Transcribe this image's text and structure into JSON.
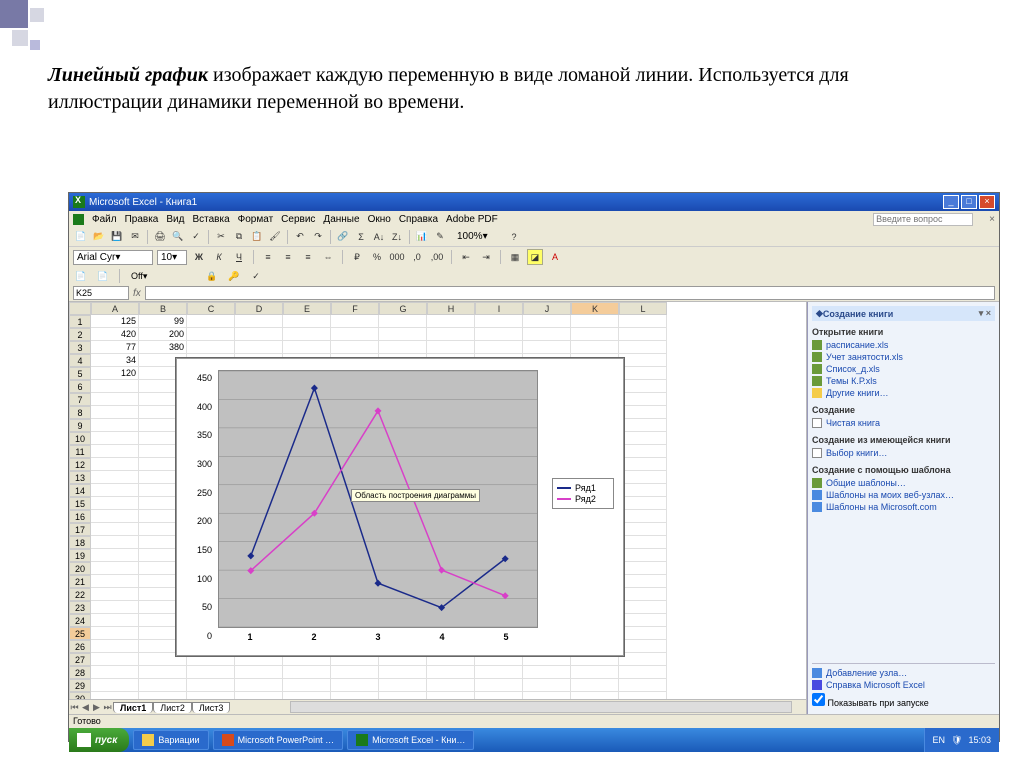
{
  "slide": {
    "term": "Линейный график",
    "rest": " изображает каждую переменную в виде ломаной линии. Используется для иллюстрации динамики переменной во времени."
  },
  "titlebar": {
    "text": "Microsoft Excel - Книга1"
  },
  "window_buttons": {
    "min": "_",
    "max": "□",
    "close": "×"
  },
  "menubar": {
    "items": [
      "Файл",
      "Правка",
      "Вид",
      "Вставка",
      "Формат",
      "Сервис",
      "Данные",
      "Окно",
      "Справка",
      "Adobe PDF"
    ],
    "question": "Введите вопрос",
    "doc_close": "×"
  },
  "fmtbar": {
    "font": "Arial Cyr",
    "size": "10",
    "bold": "Ж",
    "italic": "К",
    "underline": "Ч",
    "zoom": "100%"
  },
  "securitybar": {
    "label": "Off",
    "arrow": "▾"
  },
  "fxbar": {
    "namebox": "K25",
    "fx": "fx"
  },
  "columns": [
    "A",
    "B",
    "C",
    "D",
    "E",
    "F",
    "G",
    "H",
    "I",
    "J",
    "K",
    "L"
  ],
  "rows": 32,
  "active_cell": {
    "r": 25,
    "c": "K"
  },
  "cells": {
    "A1": "125",
    "B1": "99",
    "A2": "420",
    "B2": "200",
    "A3": "77",
    "B3": "380",
    "A4": "34",
    "A5": "120"
  },
  "chart_data": {
    "type": "line",
    "categories": [
      "1",
      "2",
      "3",
      "4",
      "5"
    ],
    "series": [
      {
        "name": "Ряд1",
        "values": [
          125,
          420,
          77,
          34,
          120
        ],
        "color": "#1a2a8a"
      },
      {
        "name": "Ряд2",
        "values": [
          99,
          200,
          380,
          100,
          55
        ],
        "color": "#d840c8"
      }
    ],
    "ylabel": "",
    "xlabel": "",
    "ylim": [
      0,
      450
    ],
    "yticks": [
      0,
      50,
      100,
      150,
      200,
      250,
      300,
      350,
      400,
      450
    ],
    "tooltip": "Область построения диаграммы"
  },
  "sheet_tabs": {
    "tabs": [
      "Лист1",
      "Лист2",
      "Лист3"
    ],
    "active": "Лист1"
  },
  "taskpane": {
    "title": "Создание книги",
    "open_head": "Открытие книги",
    "open_items": [
      "расписание.xls",
      "Учет занятости.xls",
      "Список_д.xls",
      "Темы К.Р.xls"
    ],
    "open_more": "Другие книги…",
    "create_head": "Создание",
    "create_blank": "Чистая книга",
    "from_existing_head": "Создание из имеющейся книги",
    "from_existing": "Выбор книги…",
    "templates_head": "Создание с помощью шаблона",
    "template_items": [
      "Общие шаблоны…",
      "Шаблоны на моих веб-узлах…",
      "Шаблоны на Microsoft.com"
    ],
    "bottom1": "Добавление узла…",
    "bottom2": "Справка Microsoft Excel",
    "bottom3": "Показывать при запуске"
  },
  "statusbar": {
    "text": "Готово"
  },
  "taskbar": {
    "start": "пуск",
    "items": [
      "Вариации",
      "Microsoft PowerPoint …",
      "Microsoft Excel - Кни…"
    ],
    "lang": "EN",
    "time": "15:03"
  }
}
